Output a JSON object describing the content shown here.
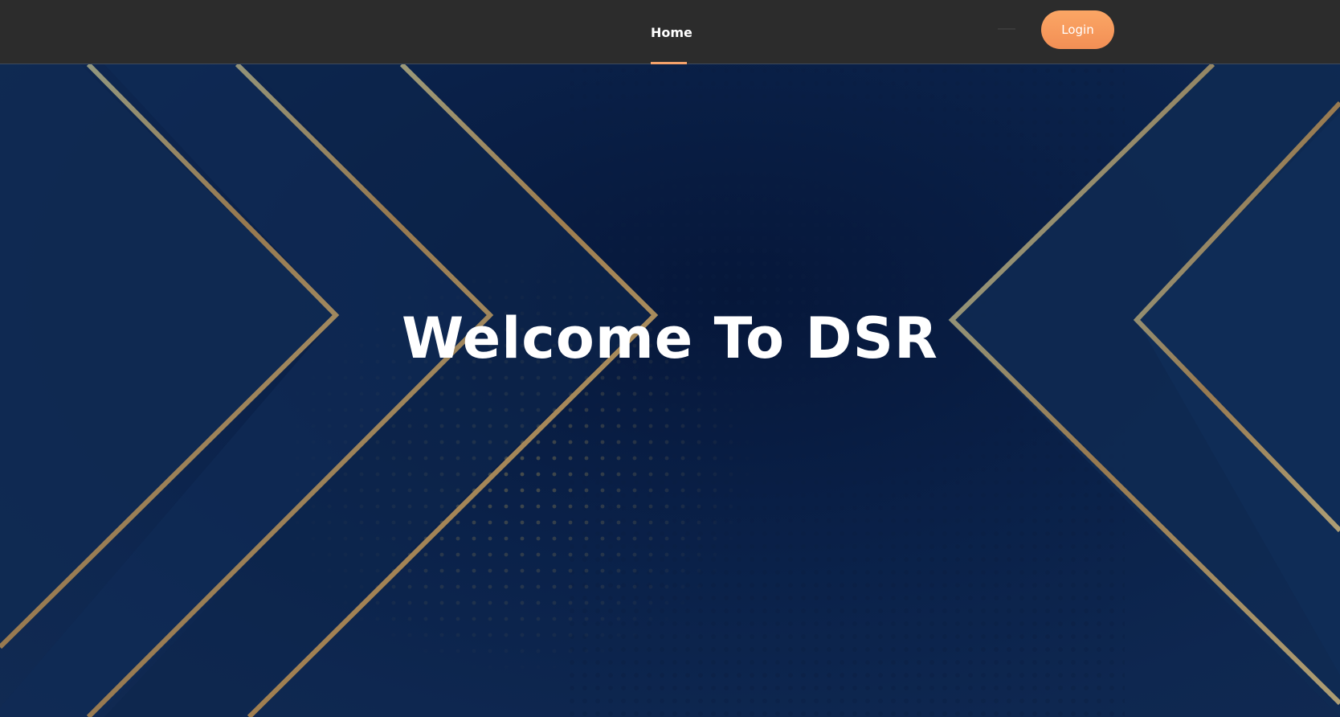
{
  "nav": {
    "home_label": "Home",
    "login_label": "Login"
  },
  "hero": {
    "title": "Welcome To DSR"
  },
  "colors": {
    "navbar_bg": "#2c2c2c",
    "accent": "#f5a26a",
    "hero_bg": "#0b1f42",
    "gold_line": "#b4905a"
  }
}
